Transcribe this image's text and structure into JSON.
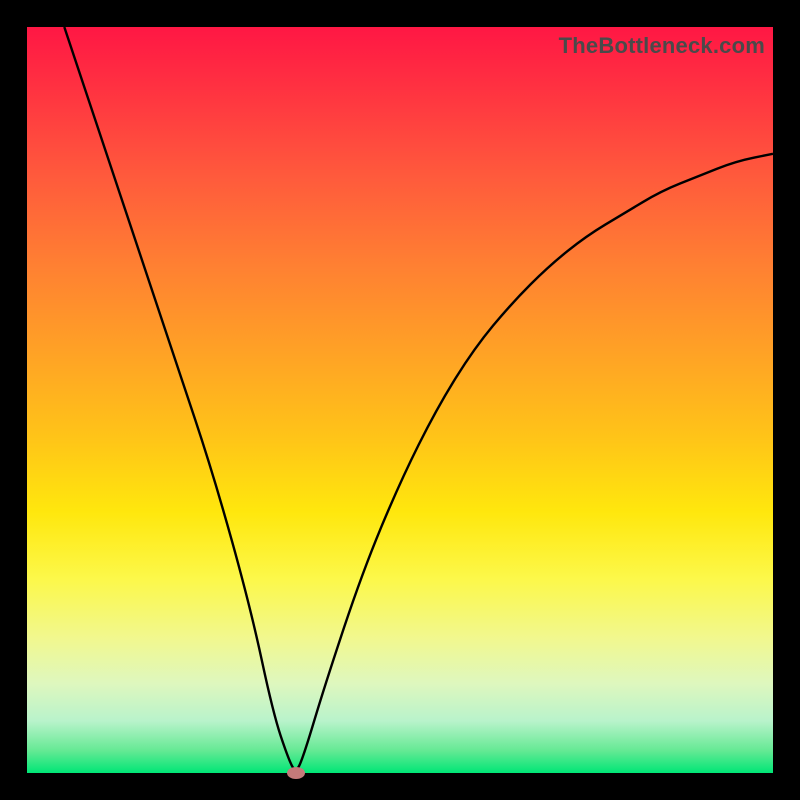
{
  "watermark": "TheBottleneck.com",
  "chart_data": {
    "type": "line",
    "title": "",
    "xlabel": "",
    "ylabel": "",
    "xlim": [
      0,
      100
    ],
    "ylim": [
      0,
      100
    ],
    "grid": false,
    "legend": false,
    "series": [
      {
        "name": "curve",
        "x": [
          5,
          10,
          15,
          20,
          25,
          30,
          33,
          35,
          36,
          37,
          40,
          45,
          50,
          55,
          60,
          65,
          70,
          75,
          80,
          85,
          90,
          95,
          100
        ],
        "y": [
          100,
          85,
          70,
          55,
          40,
          22,
          8,
          2,
          0,
          2,
          12,
          27,
          39,
          49,
          57,
          63,
          68,
          72,
          75,
          78,
          80,
          82,
          83
        ]
      }
    ],
    "marker": {
      "x": 36,
      "y": 0,
      "color": "#c47a7a"
    },
    "background_gradient": [
      "#ff1744",
      "#ffa325",
      "#ffe70d",
      "#00e676"
    ],
    "frame_color": "#000000"
  }
}
